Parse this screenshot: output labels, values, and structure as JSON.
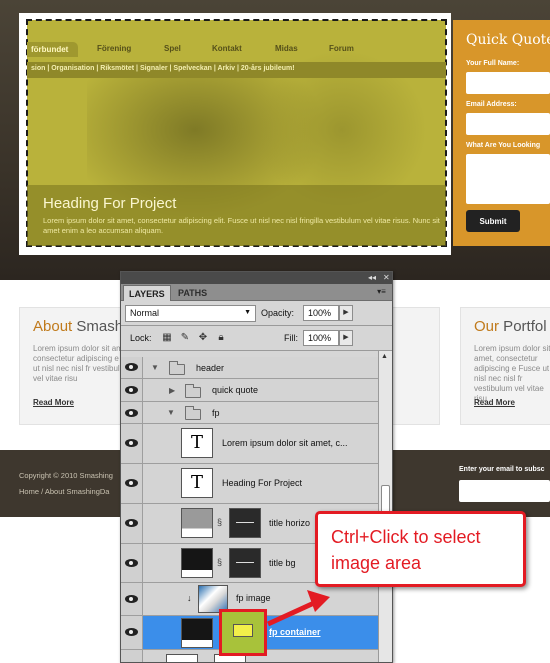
{
  "site": {
    "nav_tabs": [
      "förbundet",
      "Förening",
      "Spel",
      "Kontakt",
      "Midas",
      "Forum"
    ],
    "subnav": "sion | Organisation | Riksmötet | Signaler | Spelveckan | Arkiv | 20-års jubileum!",
    "feature_heading": "Heading For Project",
    "feature_text": "Lorem ipsum dolor sit amet, consectetur adipiscing elit. Fusce ut nisl nec nisl fringilla vestibulum vel vitae risus. Nunc sit amet enim a leo accumsan aliquam.",
    "quote": {
      "title": "Quick Quote",
      "name_label": "Your Full Name:",
      "email_label": "Email Address:",
      "looking_label": "What Are You Looking",
      "submit": "Submit"
    },
    "about": {
      "title_accent": "About",
      "title_rest": " Smash",
      "text": "Lorem ipsum dolor sit amet, consectetur adipiscing e Fusce ut nisl nec nisl fr vestibulum vel vitae risu",
      "read_more": "Read More"
    },
    "portfolio": {
      "title_accent": "Our",
      "title_rest": " Portfol",
      "text": "Lorem ipsum dolor sit amet, consectetur adipiscing e Fusce ut nisl nec nisl fr vestibulum vel vitae risu",
      "read_more": "Read More"
    },
    "footer": {
      "copyright": "Copyright © 2010 Smashing",
      "breadcrumb": "Home  /  About SmashingDa",
      "newsletter_label": "Enter your email to subsc"
    }
  },
  "layers_panel": {
    "collapse_btn": "◂◂",
    "close_btn": "✕",
    "tabs": [
      "LAYERS",
      "PATHS"
    ],
    "menu_icon": "panel-menu-icon",
    "blend_mode": "Normal",
    "opacity_label": "Opacity:",
    "opacity_value": "100%",
    "lock_label": "Lock:",
    "fill_label": "Fill:",
    "fill_value": "100%",
    "layers": [
      {
        "name": "header",
        "type": "group"
      },
      {
        "name": "quick quote",
        "type": "group"
      },
      {
        "name": "fp",
        "type": "group"
      },
      {
        "name": "Lorem ipsum dolor sit amet, c...",
        "type": "text"
      },
      {
        "name": "Heading For Project",
        "type": "text"
      },
      {
        "name": "title horizo",
        "type": "shape"
      },
      {
        "name": "title bg",
        "type": "shape"
      },
      {
        "name": "fp image",
        "type": "image"
      },
      {
        "name": "fp container",
        "type": "shape",
        "selected": true
      }
    ]
  },
  "callout": {
    "text": "Ctrl+Click to select image area",
    "color": "#e31b23"
  }
}
